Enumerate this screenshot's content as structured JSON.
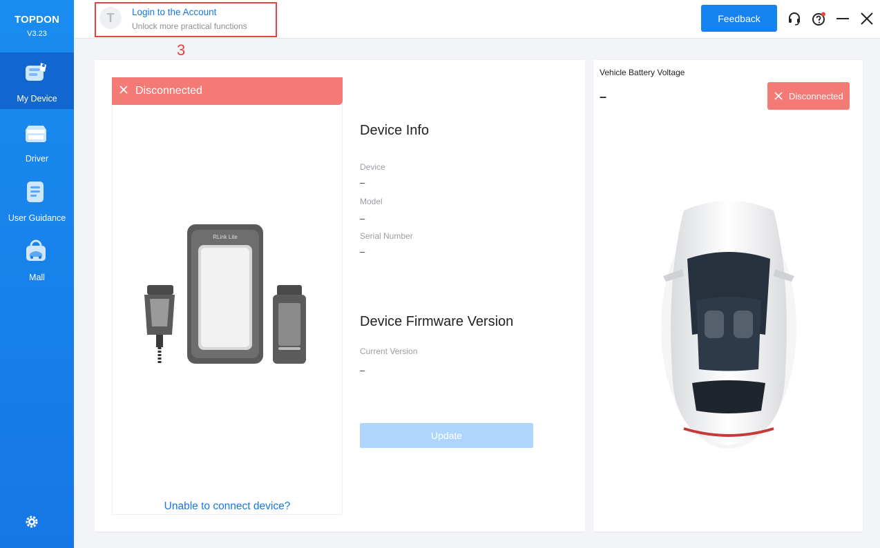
{
  "brand": {
    "name": "TOPDON",
    "version": "V3.23"
  },
  "sidebar": {
    "items": [
      {
        "label": "My Device",
        "icon": "my-device-icon",
        "active": true
      },
      {
        "label": "Driver",
        "icon": "driver-icon",
        "active": false
      },
      {
        "label": "User Guidance",
        "icon": "user-guidance-icon",
        "active": false
      },
      {
        "label": "Mall",
        "icon": "mall-icon",
        "active": false
      }
    ],
    "settings_icon": "gear-icon"
  },
  "header": {
    "login": {
      "avatar_letter": "T",
      "title": "Login to the Account",
      "subtitle": "Unlock more practical functions"
    },
    "annotation": "3",
    "feedback_label": "Feedback",
    "icons": [
      "headset-icon",
      "help-icon",
      "minimize-icon",
      "close-icon"
    ]
  },
  "device": {
    "status": "Disconnected",
    "model_label": "RLink Lite",
    "unable_link": "Unable to connect device?"
  },
  "device_info": {
    "title": "Device Info",
    "fields": [
      {
        "label": "Device",
        "value": "–"
      },
      {
        "label": "Model",
        "value": "–"
      },
      {
        "label": "Serial Number",
        "value": "–"
      }
    ]
  },
  "firmware": {
    "title": "Device Firmware Version",
    "current_label": "Current Version",
    "current_value": "–",
    "update_label": "Update"
  },
  "battery": {
    "label": "Vehicle Battery Voltage",
    "value": "–",
    "status": "Disconnected"
  },
  "colors": {
    "sidebar": "#1a8cf0",
    "accent": "#1682f0",
    "disconnected": "#f47a76",
    "annotation": "#e8403e"
  }
}
